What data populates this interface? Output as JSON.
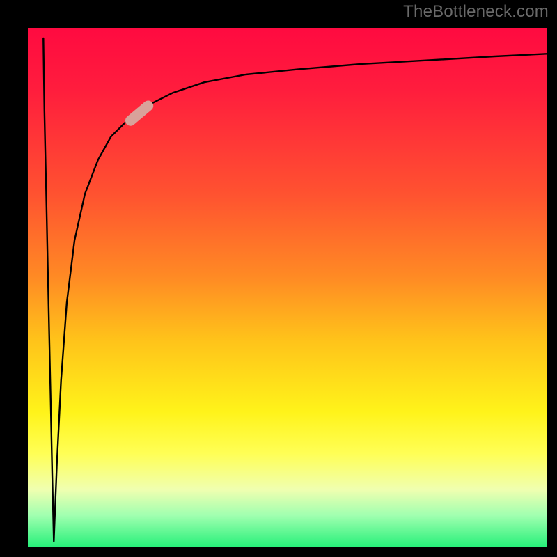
{
  "watermark": "TheBottleneck.com",
  "chart_data": {
    "type": "line",
    "title": "",
    "xlabel": "",
    "ylabel": "",
    "xlim": [
      0,
      1
    ],
    "ylim": [
      0,
      1
    ],
    "grid": false,
    "legend": false,
    "series": [
      {
        "name": "curve-down",
        "x": [
          0.03,
          0.032,
          0.035,
          0.038,
          0.041,
          0.044,
          0.047,
          0.05
        ],
        "y": [
          0.98,
          0.84,
          0.7,
          0.56,
          0.42,
          0.28,
          0.14,
          0.01
        ]
      },
      {
        "name": "curve-up",
        "x": [
          0.05,
          0.056,
          0.064,
          0.075,
          0.09,
          0.11,
          0.135,
          0.16,
          0.19,
          0.23,
          0.28,
          0.34,
          0.42,
          0.52,
          0.64,
          0.78,
          0.9,
          1.0
        ],
        "y": [
          0.01,
          0.16,
          0.32,
          0.47,
          0.59,
          0.68,
          0.745,
          0.79,
          0.82,
          0.85,
          0.875,
          0.895,
          0.91,
          0.92,
          0.93,
          0.938,
          0.945,
          0.95
        ]
      }
    ],
    "background_gradient": {
      "top": "#ff0a40",
      "mid": "#fff31a",
      "bottom": "#28f07a"
    },
    "marker": {
      "cx": 0.215,
      "cy": 0.835,
      "angle_deg": 40,
      "width_frac": 0.065,
      "height_frac": 0.02,
      "color": "#d9a29a"
    }
  }
}
